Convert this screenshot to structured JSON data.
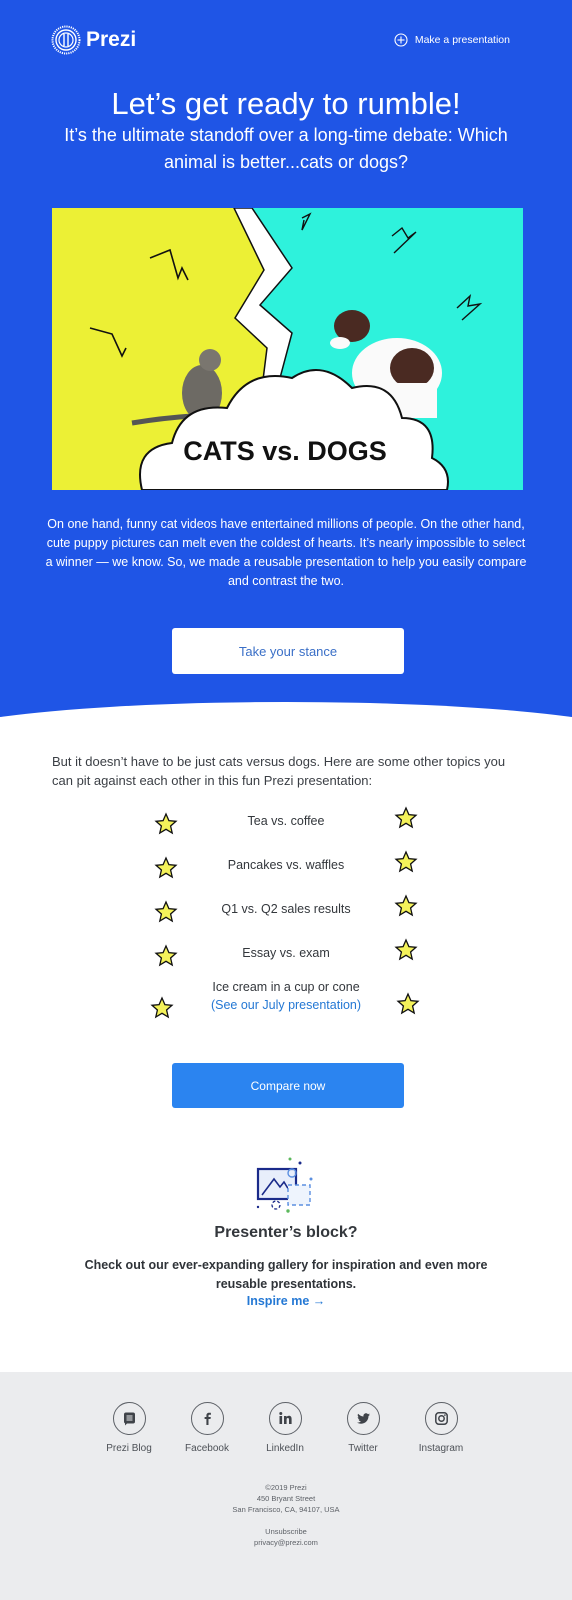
{
  "header": {
    "brand": "Prezi",
    "make_presentation_label": "Make a presentation"
  },
  "hero": {
    "headline": "Let’s get ready to rumble!",
    "subhead": "It’s the ultimate standoff over a long-time debate: Which animal is better...cats or dogs?",
    "image_caption": "CATS vs. DOGS",
    "image_colors": {
      "left": "#ecf035",
      "right": "#2ef2dc"
    },
    "intro": "On one hand, funny cat videos have entertained millions of people. On the other hand, cute puppy pictures can melt even the coldest of hearts. It’s nearly impossible to select a winner — we know. So, we made a reusable presentation to help you easily compare and contrast the two.",
    "cta_label": "Take your stance"
  },
  "topics": {
    "lead": "But it doesn’t have to be just cats versus dogs. Here are some other topics you can pit against each other in this fun Prezi presentation:",
    "items": [
      {
        "text": "Tea vs. coffee"
      },
      {
        "text": "Pancakes vs. waffles"
      },
      {
        "text": "Q1 vs. Q2 sales results"
      },
      {
        "text": "Essay vs. exam"
      },
      {
        "text": "Ice cream in a cup or cone",
        "link": "(See our July presentation)"
      }
    ],
    "cta_label": "Compare now"
  },
  "presenter_block": {
    "icon": "image-gallery-icon",
    "title": "Presenter’s block?",
    "text": "Check out our ever-expanding gallery for inspiration and even more reusable presentations.",
    "link_label": "Inspire me →"
  },
  "footer": {
    "socials": [
      {
        "label": "Prezi Blog",
        "icon": "blog-icon"
      },
      {
        "label": "Facebook",
        "icon": "facebook-icon"
      },
      {
        "label": "LinkedIn",
        "icon": "linkedin-icon"
      },
      {
        "label": "Twitter",
        "icon": "twitter-icon"
      },
      {
        "label": "Instagram",
        "icon": "instagram-icon"
      }
    ],
    "copyright": "©2019 Prezi",
    "address_line1": "450 Bryant Street",
    "address_line2": "San Francisco, CA, 94107, USA",
    "unsubscribe": "Unsubscribe",
    "privacy_email": "privacy@prezi.com"
  },
  "colors": {
    "brand_blue": "#1f55e6",
    "button_blue": "#2b84f0",
    "link_blue": "#2478d4",
    "star_yellow": "#f4f25a",
    "footer_bg": "#ebecee"
  }
}
